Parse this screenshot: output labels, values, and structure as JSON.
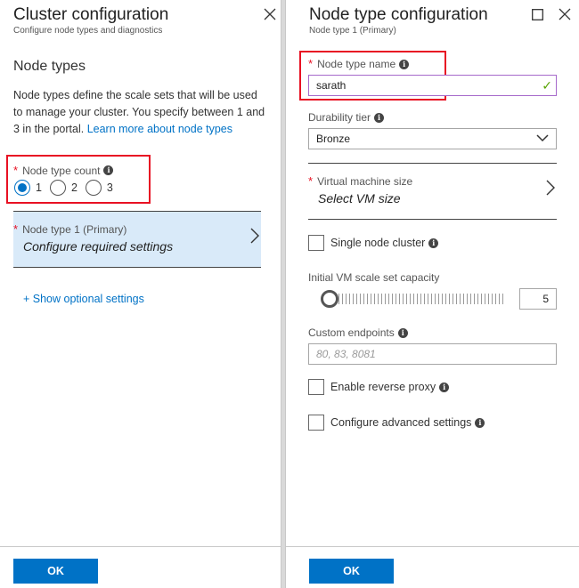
{
  "left_blade": {
    "title": "Cluster configuration",
    "subtitle": "Configure node types and diagnostics",
    "section_title": "Node types",
    "description": "Node types define the scale sets that will be used to manage your cluster. You specify between 1 and 3 in the portal.",
    "learn_more_link": "Learn more about node types",
    "node_type_count": {
      "label": "Node type count",
      "options": [
        "1",
        "2",
        "3"
      ],
      "selected": "1"
    },
    "node_type_item": {
      "label": "Node type 1 (Primary)",
      "value": "Configure required settings"
    },
    "show_optional": "+ Show optional settings",
    "ok_label": "OK"
  },
  "right_blade": {
    "title": "Node type configuration",
    "subtitle": "Node type 1 (Primary)",
    "node_type_name": {
      "label": "Node type name",
      "value": "sarath"
    },
    "durability_tier": {
      "label": "Durability tier",
      "value": "Bronze"
    },
    "vm_size": {
      "label": "Virtual machine size",
      "value": "Select VM size"
    },
    "single_node_cluster": "Single node cluster",
    "initial_capacity": {
      "label": "Initial VM scale set capacity",
      "value": "5"
    },
    "custom_endpoints": {
      "label": "Custom endpoints",
      "placeholder": "80, 83, 8081"
    },
    "enable_reverse_proxy": "Enable reverse proxy",
    "configure_advanced": "Configure advanced settings",
    "ok_label": "OK"
  },
  "colors": {
    "accent": "#0072c6",
    "required": "#e81123",
    "selected_bg": "#d9eaf9",
    "valid_check": "#57a300"
  }
}
